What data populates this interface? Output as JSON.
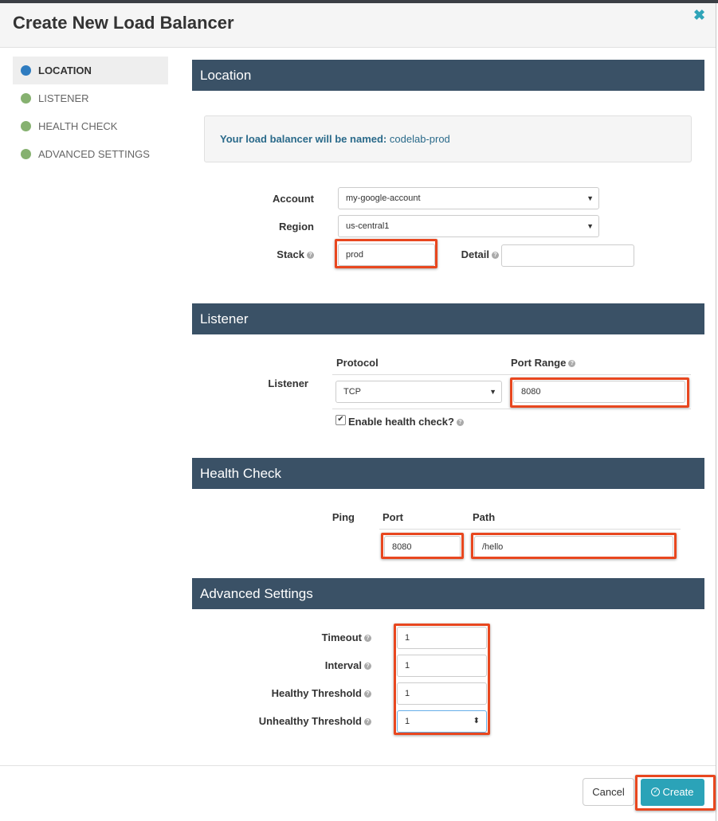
{
  "modal": {
    "title": "Create New Load Balancer",
    "close_icon": "close-icon"
  },
  "nav": {
    "items": [
      {
        "label": "LOCATION",
        "active": true
      },
      {
        "label": "LISTENER",
        "active": false
      },
      {
        "label": "HEALTH CHECK",
        "active": false
      },
      {
        "label": "ADVANCED SETTINGS",
        "active": false
      }
    ]
  },
  "location": {
    "section_title": "Location",
    "name_prefix": "Your load balancer will be named:",
    "name_value": "codelab-prod",
    "account_label": "Account",
    "account_value": "my-google-account",
    "region_label": "Region",
    "region_value": "us-central1",
    "stack_label": "Stack",
    "stack_value": "prod",
    "detail_label": "Detail",
    "detail_value": ""
  },
  "listener": {
    "section_title": "Listener",
    "row_label": "Listener",
    "protocol_header": "Protocol",
    "port_range_header": "Port Range",
    "protocol_value": "TCP",
    "port_range_value": "8080",
    "enable_health_check_label": "Enable health check?",
    "enable_health_check": true
  },
  "health_check": {
    "section_title": "Health Check",
    "ping_label": "Ping",
    "port_header": "Port",
    "path_header": "Path",
    "port_value": "8080",
    "path_value": "/hello"
  },
  "advanced": {
    "section_title": "Advanced Settings",
    "timeout_label": "Timeout",
    "timeout_value": "1",
    "interval_label": "Interval",
    "interval_value": "1",
    "healthy_label": "Healthy Threshold",
    "healthy_value": "1",
    "unhealthy_label": "Unhealthy Threshold",
    "unhealthy_value": "1"
  },
  "footer": {
    "cancel_label": "Cancel",
    "create_label": "Create"
  },
  "colors": {
    "section_bar": "#3a5166",
    "accent": "#2ba3b8",
    "active_dot": "#2f7cc0",
    "step_dot": "#86b170",
    "highlight": "#e8471f"
  }
}
